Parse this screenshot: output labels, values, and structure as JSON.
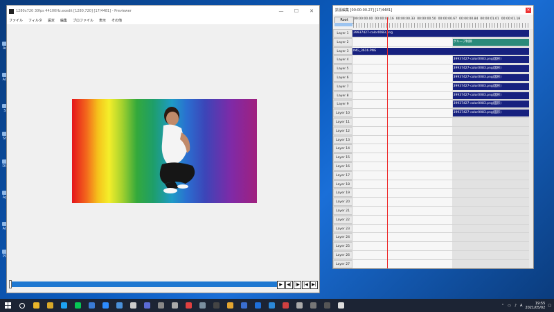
{
  "desktop": {
    "icons": [
      {
        "label": "Ac"
      },
      {
        "label": "AC"
      },
      {
        "label": "S"
      },
      {
        "label": "Sh"
      },
      {
        "label": "DV"
      },
      {
        "label": "Ap"
      },
      {
        "label": "AC"
      },
      {
        "label": "PC"
      }
    ]
  },
  "main_window": {
    "title": "1280x720 30fps 44100Hz.exedit [1280,720] [17/4481] - Previewer",
    "menu": [
      "ファイル",
      "フィルタ",
      "設定",
      "編集",
      "プロファイル",
      "表示",
      "その他"
    ],
    "seek_controls": [
      "▶",
      "◀|",
      "|▶",
      "|◀",
      "▶|"
    ]
  },
  "timeline_window": {
    "title": "拡張編集 [00:00:00.27] [17/4481]",
    "close_label": "×",
    "root_label": "Root",
    "ruler_times": [
      "00:00:00.00",
      "00:00:00.16",
      "00:00:00.33",
      "00:00:00.50",
      "00:00:00.67",
      "00:00:00.84",
      "00:00:01.01",
      "00:00:01.18"
    ],
    "layers": [
      {
        "label": "Layer 1",
        "clips": [
          {
            "text": "39937427-color0083.png",
            "start": 0.0,
            "end": 1.0,
            "style": "blue"
          }
        ]
      },
      {
        "label": "Layer 2",
        "clips": [
          {
            "text": "グループ制御",
            "start": 0.565,
            "end": 1.0,
            "style": "green"
          }
        ]
      },
      {
        "label": "Layer 3",
        "clips": [
          {
            "text": "IMG_3616.PNG",
            "start": 0.0,
            "end": 1.0,
            "style": "blue"
          }
        ]
      },
      {
        "label": "Layer 4",
        "clips": [
          {
            "text": "39937427-color0083.png(図形)",
            "start": 0.565,
            "end": 1.0,
            "style": "blue"
          }
        ]
      },
      {
        "label": "Layer 5",
        "clips": [
          {
            "text": "39937427-color0083.png(図形)",
            "start": 0.565,
            "end": 1.0,
            "style": "blue"
          }
        ]
      },
      {
        "label": "Layer 6",
        "clips": [
          {
            "text": "39937427-color0083.png(図形)",
            "start": 0.565,
            "end": 1.0,
            "style": "blue"
          }
        ]
      },
      {
        "label": "Layer 7",
        "clips": [
          {
            "text": "39937427-color0083.png(図形)",
            "start": 0.565,
            "end": 1.0,
            "style": "blue"
          }
        ]
      },
      {
        "label": "Layer 8",
        "clips": [
          {
            "text": "39937427-color0083.png(図形)",
            "start": 0.565,
            "end": 1.0,
            "style": "blue"
          }
        ]
      },
      {
        "label": "Layer 9",
        "clips": [
          {
            "text": "39937427-color0083.png(図形)",
            "start": 0.565,
            "end": 1.0,
            "style": "blue"
          }
        ]
      },
      {
        "label": "Layer 10",
        "clips": [
          {
            "text": "39937427-color0083.png(図形)",
            "start": 0.565,
            "end": 1.0,
            "style": "blue"
          }
        ]
      },
      {
        "label": "Layer 11",
        "clips": []
      },
      {
        "label": "Layer 12",
        "clips": []
      },
      {
        "label": "Layer 13",
        "clips": []
      },
      {
        "label": "Layer 14",
        "clips": []
      },
      {
        "label": "Layer 15",
        "clips": []
      },
      {
        "label": "Layer 16",
        "clips": []
      },
      {
        "label": "Layer 17",
        "clips": []
      },
      {
        "label": "Layer 18",
        "clips": []
      },
      {
        "label": "Layer 19",
        "clips": []
      },
      {
        "label": "Layer 20",
        "clips": []
      },
      {
        "label": "Layer 21",
        "clips": []
      },
      {
        "label": "Layer 22",
        "clips": []
      },
      {
        "label": "Layer 23",
        "clips": []
      },
      {
        "label": "Layer 24",
        "clips": []
      },
      {
        "label": "Layer 25",
        "clips": []
      },
      {
        "label": "Layer 26",
        "clips": []
      },
      {
        "label": "Layer 27",
        "clips": []
      }
    ]
  },
  "taskbar": {
    "apps": [
      {
        "name": "search-icon",
        "color": "#ffffff"
      },
      {
        "name": "chrome-icon",
        "color": "#e9b52a"
      },
      {
        "name": "explorer-icon",
        "color": "#d9a929"
      },
      {
        "name": "twitter-icon",
        "color": "#1da1f2"
      },
      {
        "name": "line-icon",
        "color": "#06c755"
      },
      {
        "name": "photos-icon",
        "color": "#3a7bd5"
      },
      {
        "name": "zoom-icon",
        "color": "#2d8cff"
      },
      {
        "name": "gallery-icon",
        "color": "#4a90d9"
      },
      {
        "name": "feather-icon",
        "color": "#cccccc"
      },
      {
        "name": "app-icon",
        "color": "#5b6bd6"
      },
      {
        "name": "app-icon-2",
        "color": "#888888"
      },
      {
        "name": "settings-icon",
        "color": "#aaaaaa"
      },
      {
        "name": "record-icon",
        "color": "#e04040"
      },
      {
        "name": "tool-icon",
        "color": "#7a8fa0"
      },
      {
        "name": "app-icon-3",
        "color": "#444444"
      },
      {
        "name": "headset-icon",
        "color": "#e3a530"
      },
      {
        "name": "app-icon-4",
        "color": "#3a6ed0"
      },
      {
        "name": "mail-icon",
        "color": "#1e6fd9"
      },
      {
        "name": "app-icon-5",
        "color": "#2b88d8"
      },
      {
        "name": "app-icon-6",
        "color": "#d04040"
      },
      {
        "name": "app-icon-7",
        "color": "#aaaaaa"
      },
      {
        "name": "app-icon-8",
        "color": "#777777"
      },
      {
        "name": "app-icon-9",
        "color": "#555555"
      },
      {
        "name": "app-icon-10",
        "color": "#dddddd"
      }
    ],
    "tray": {
      "ime": "A",
      "time": "19:55",
      "date": "2021/05/02"
    }
  }
}
